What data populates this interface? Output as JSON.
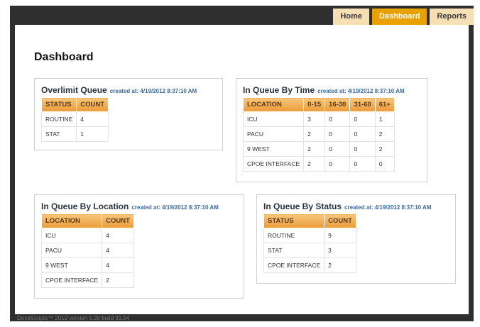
{
  "nav": {
    "tabs": [
      {
        "label": "Home",
        "active": false
      },
      {
        "label": "Dashboard",
        "active": true
      },
      {
        "label": "Reports",
        "active": false
      }
    ]
  },
  "page": {
    "title": "Dashboard"
  },
  "panels": {
    "overlimit": {
      "title": "Overlimit Queue",
      "created": "created at: 4/19/2012 8:37:10 AM",
      "headers": [
        "STATUS",
        "COUNT"
      ],
      "rows": [
        [
          "ROUTINE",
          "4"
        ],
        [
          "STAT",
          "1"
        ]
      ]
    },
    "by_time": {
      "title": "In Queue By Time",
      "created": "created at: 4/19/2012 8:37:10 AM",
      "headers": [
        "LOCATION",
        "0-15",
        "16-30",
        "31-60",
        "61+"
      ],
      "rows": [
        [
          "ICU",
          "3",
          "0",
          "0",
          "1"
        ],
        [
          "PACU",
          "2",
          "0",
          "0",
          "2"
        ],
        [
          "9 WEST",
          "2",
          "0",
          "0",
          "2"
        ],
        [
          "CPOE INTERFACE",
          "2",
          "0",
          "0",
          "0"
        ]
      ]
    },
    "by_location": {
      "title": "In Queue By Location",
      "created": "created at: 4/19/2012 8:37:10 AM",
      "headers": [
        "LOCATION",
        "COUNT"
      ],
      "rows": [
        [
          "ICU",
          "4"
        ],
        [
          "PACU",
          "4"
        ],
        [
          "9 WEST",
          "4"
        ],
        [
          "CPOE INTERFACE",
          "2"
        ]
      ]
    },
    "by_status": {
      "title": "In Queue By Status",
      "created": "created at: 4/19/2012 8:37:10 AM",
      "headers": [
        "STATUS",
        "COUNT"
      ],
      "rows": [
        [
          "ROUTINE",
          "9"
        ],
        [
          "STAT",
          "3"
        ],
        [
          "CPOE INTERFACE",
          "2"
        ]
      ]
    }
  },
  "footer": {
    "text": "DocuScripts™ 2012 version 5.39 build 91.54"
  }
}
